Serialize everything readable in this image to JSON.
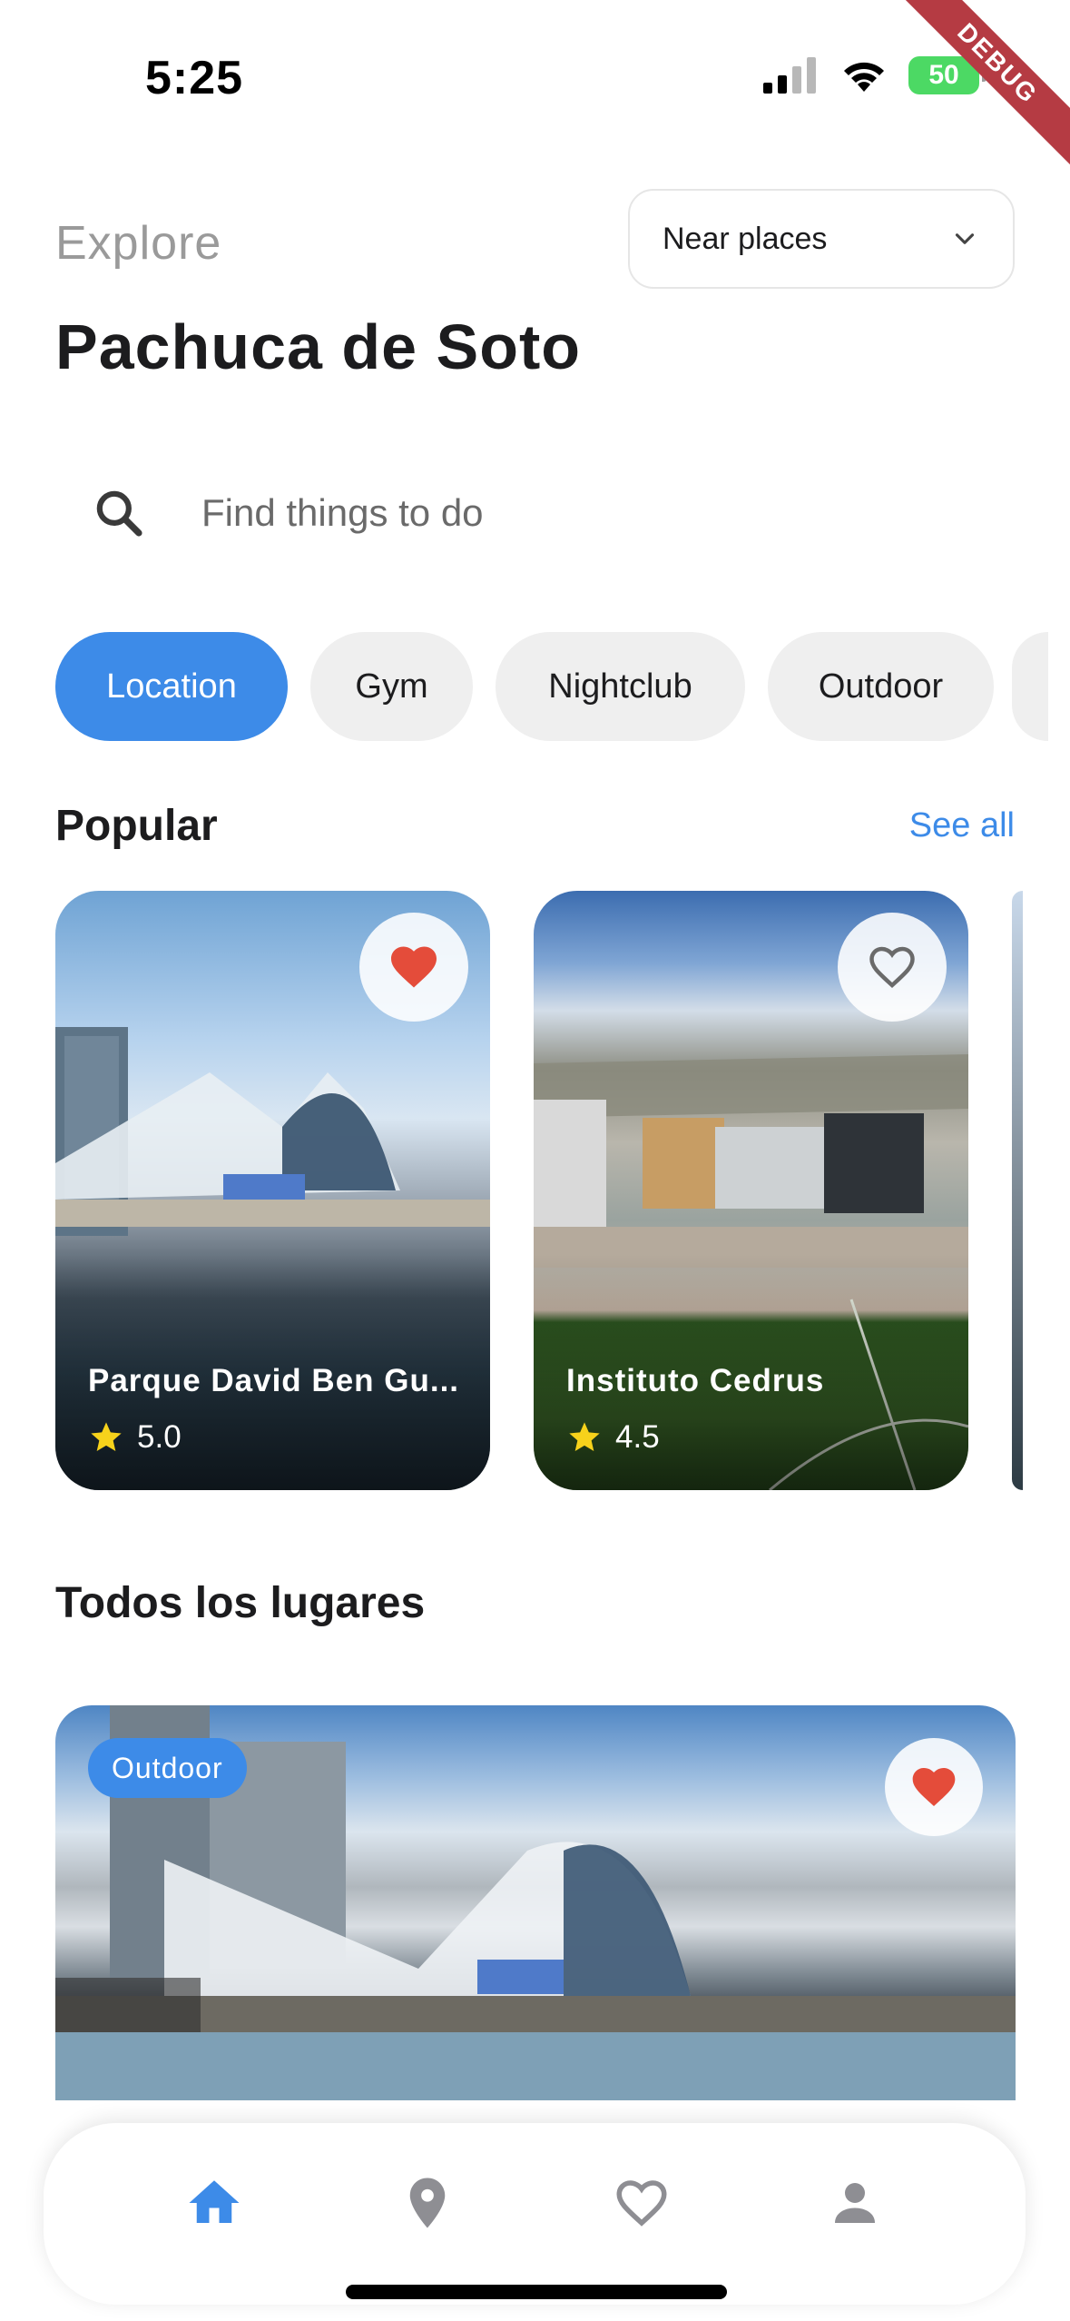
{
  "status_bar": {
    "time": "5:25",
    "battery": "50",
    "debug_label": "DEBUG"
  },
  "header": {
    "explore_label": "Explore",
    "city": "Pachuca de Soto",
    "near_select": {
      "value": "Near places",
      "icon": "chevron-down-icon"
    }
  },
  "search": {
    "placeholder": "Find things to do",
    "icon": "search-icon"
  },
  "categories": [
    {
      "label": "Location",
      "active": true
    },
    {
      "label": "Gym",
      "active": false
    },
    {
      "label": "Nightclub",
      "active": false
    },
    {
      "label": "Outdoor",
      "active": false
    }
  ],
  "popular": {
    "title": "Popular",
    "see_all": "See all",
    "cards": [
      {
        "name": "Parque David Ben Gu...",
        "rating": "5.0",
        "favorite": true
      },
      {
        "name": "Instituto Cedrus",
        "rating": "4.5",
        "favorite": false
      }
    ]
  },
  "all_places": {
    "title": "Todos los lugares",
    "card": {
      "tag": "Outdoor",
      "favorite": true
    }
  },
  "bottom_nav": {
    "items": [
      {
        "icon": "home-icon",
        "active": true
      },
      {
        "icon": "location-pin-icon",
        "active": false
      },
      {
        "icon": "heart-icon",
        "active": false
      },
      {
        "icon": "person-icon",
        "active": false
      }
    ]
  },
  "colors": {
    "accent": "#3d8be8",
    "favorite": "#e44c3a",
    "chip_bg": "#efefef",
    "inactive_icon": "#8e8e93"
  }
}
